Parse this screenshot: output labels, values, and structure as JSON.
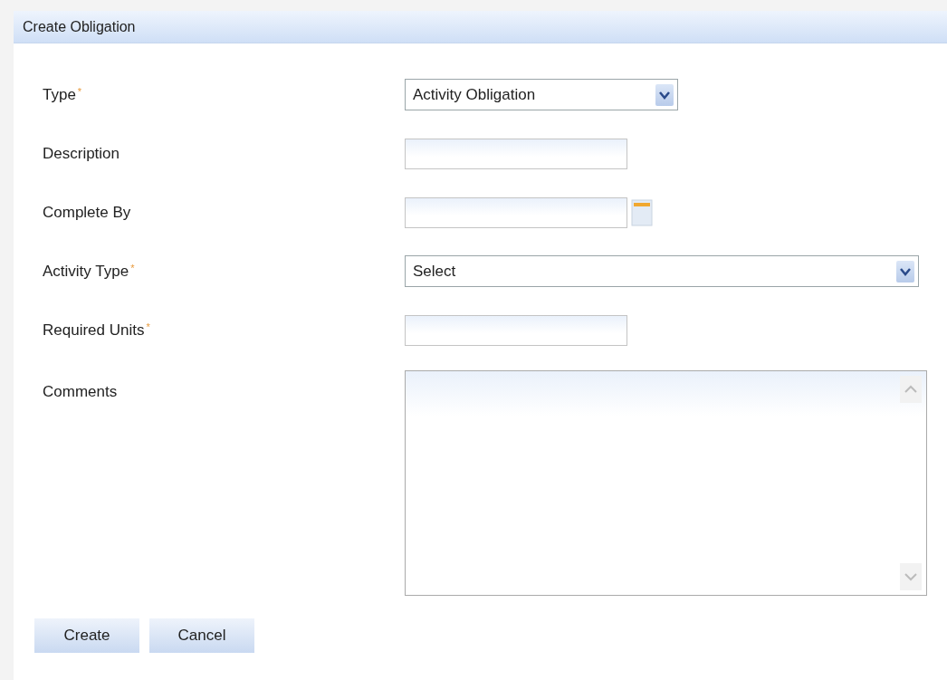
{
  "panel": {
    "title": "Create Obligation"
  },
  "fields": [
    {
      "kind": "select",
      "label": "Type",
      "required_mark": "*",
      "value": "Activity Obligation"
    },
    {
      "kind": "text",
      "label": "Description"
    },
    {
      "kind": "date",
      "label": "Complete By"
    },
    {
      "kind": "wide_select",
      "label": "Activity Type",
      "required_mark": "*",
      "value": "Select"
    },
    {
      "kind": "text",
      "label": "Required Units",
      "required_mark": "*"
    },
    {
      "kind": "textarea",
      "label": "Comments"
    }
  ],
  "buttons": [
    "Create",
    "Cancel"
  ]
}
